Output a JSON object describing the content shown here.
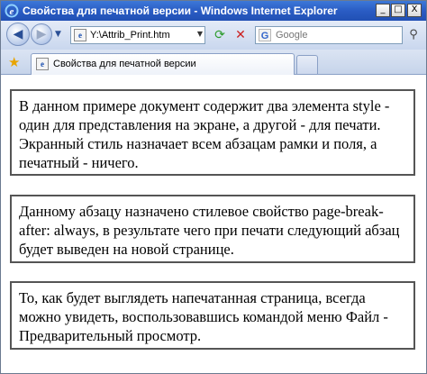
{
  "window": {
    "title": "Свойства для печатной версии - Windows Internet Explorer",
    "controls": {
      "minimize": "_",
      "maximize": "□",
      "close": "X"
    }
  },
  "navigation": {
    "back_icon": "back-arrow-icon",
    "forward_icon": "forward-arrow-icon",
    "address": "Y:\\Attrib_Print.htm",
    "search_placeholder": "Google",
    "search_provider_glyph": "G"
  },
  "tabs": [
    {
      "label": "Свойства для печатной версии",
      "active": true
    }
  ],
  "content": {
    "paragraphs": [
      "В данном примере документ содержит два элемента style - один для представления на экране, а другой - для печати. Экранный стиль назначает всем абзацам рамки и поля, а печатный - ничего.",
      "Данному абзацу назначено стилевое свойство page-break-after: always, в результате чего при печати следующий абзац будет выведен на новой странице.",
      "То, как будет выглядеть напечатанная страница, всегда можно увидеть, воспользовавшись командой меню Файл - Предварительный просмотр."
    ]
  },
  "colors": {
    "titlebar": "#2a5cc4",
    "paragraph_border": "#555555"
  }
}
